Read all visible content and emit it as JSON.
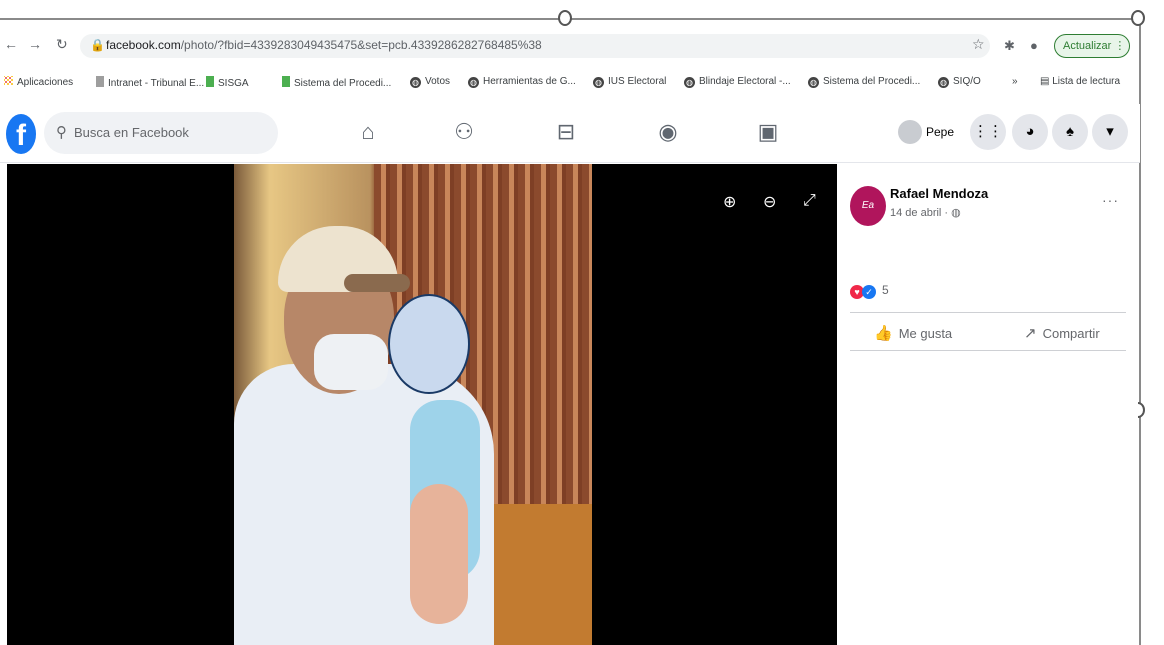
{
  "browser": {
    "url_host": "facebook.com",
    "url_rest": "/photo/?fbid=4339283049435475&set=pcb.4339286282768485%38",
    "update_label": "Actualizar"
  },
  "bookmarks": [
    "Aplicaciones",
    "Intranet - Tribunal E...",
    "SISGA",
    "Sistema del Procedi...",
    "Votos",
    "Herramientas de G...",
    "IUS Electoral",
    "Blindaje Electoral -...",
    "Sistema del Procedi...",
    "SIQ/O"
  ],
  "reading_list": "Lista de lectura",
  "facebook": {
    "logo": "f",
    "search_placeholder": "Busca en Facebook",
    "profile_name": "Pepe"
  },
  "post": {
    "author": "Rafael Mendoza",
    "date": "14 de abril · ",
    "reaction_count": "5",
    "like_label": "Me gusta",
    "share_label": "Compartir"
  },
  "icons": {
    "home": "home-icon",
    "friends": "friends-icon",
    "marketplace": "marketplace-icon",
    "groups": "groups-icon",
    "gaming": "gaming-icon"
  },
  "colors": {
    "facebook_blue": "#1877f2",
    "update_green": "#2e7d32",
    "avatar_magenta": "#b0155c"
  }
}
